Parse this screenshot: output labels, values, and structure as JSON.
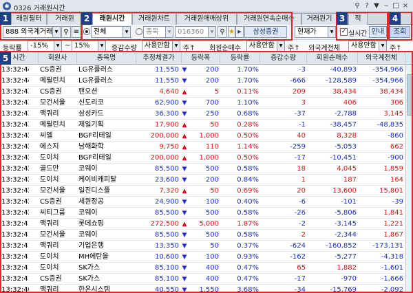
{
  "window": {
    "title": "0326 거래원시간",
    "controls": [
      "⚲",
      "?",
      "▼",
      "‒",
      "□",
      "×"
    ]
  },
  "tabs": [
    {
      "label": "래원필터",
      "active": false
    },
    {
      "label": "거래원",
      "active": false
    },
    {
      "label": "래원시간",
      "active": true
    },
    {
      "label": "거래원차트",
      "active": false
    },
    {
      "label": "거래원매매상위",
      "active": false
    },
    {
      "label": "거래원연속순매수",
      "active": false
    },
    {
      "label": "거래원기",
      "active": false
    },
    {
      "label": "적",
      "active": false
    }
  ],
  "controls": {
    "broker_select": "888 외국계거래원",
    "radio_all": "전체",
    "radio_stock": "종목",
    "stock_code": "016360",
    "stock_name": "삼성증권",
    "price_type": "현재가",
    "realtime_label": "실시간",
    "realtime_checked": true,
    "guide_button": "안내",
    "query_button": "조회"
  },
  "filters": {
    "rate_label": "등락률",
    "rate_from": "-15%",
    "rate_tilde": "~",
    "rate_to": "15%",
    "vol_label": "증감수량",
    "vol_value": "사용안함",
    "vol_unit": "주↑",
    "net_label": "회원순매수",
    "net_value": "사용안함",
    "net_unit": "주↑",
    "for_label": "외국계전체",
    "for_value": "사용안함",
    "for_unit": "주↑"
  },
  "markers": [
    "1",
    "2",
    "3",
    "4",
    "5"
  ],
  "table": {
    "headers": [
      "시간",
      "회원사",
      "종목명",
      "추정체결가",
      "등락폭",
      "등락률",
      "증감수량",
      "회원순매수",
      "외국계전체"
    ],
    "rows": [
      {
        "time": "13:32:44",
        "firm": "CS증권",
        "stock": "LG유플러스",
        "price": "11,550",
        "dir": "down",
        "chg": "200",
        "rate": "1.70%",
        "vol": "-3",
        "net": "-40,893",
        "for": "-354,966"
      },
      {
        "time": "13:32:44",
        "firm": "메릴린치",
        "stock": "LG유플러스",
        "price": "11,550",
        "dir": "down",
        "chg": "200",
        "rate": "1.70%",
        "vol": "-666",
        "net": "-128,589",
        "for": "-354,966"
      },
      {
        "time": "13:32:43",
        "firm": "CS증권",
        "stock": "팬오션",
        "price": "4,640",
        "dir": "up",
        "chg": "5",
        "rate": "0.11%",
        "vol": "209",
        "net": "38,434",
        "for": "38,434"
      },
      {
        "time": "13:32:43",
        "firm": "모건서울",
        "stock": "신도리코",
        "price": "62,900",
        "dir": "down",
        "chg": "700",
        "rate": "1.10%",
        "vol": "3",
        "net": "406",
        "for": "306"
      },
      {
        "time": "13:32:43",
        "firm": "맥쿼리",
        "stock": "삼성카드",
        "price": "36,300",
        "dir": "down",
        "chg": "250",
        "rate": "0.68%",
        "vol": "-37",
        "net": "-2,788",
        "for": "3,145"
      },
      {
        "time": "13:32:43",
        "firm": "메릴린치",
        "stock": "제일기획",
        "price": "17,900",
        "dir": "up",
        "chg": "50",
        "rate": "0.28%",
        "vol": "-1",
        "net": "-38,457",
        "for": "-48,835"
      },
      {
        "time": "13:32:42",
        "firm": "씨엘",
        "stock": "BGF리테일",
        "price": "200,000",
        "dir": "up",
        "chg": "1,000",
        "rate": "0.50%",
        "vol": "40",
        "net": "8,328",
        "for": "-860"
      },
      {
        "time": "13:32:42",
        "firm": "에스지",
        "stock": "남해화학",
        "price": "9,750",
        "dir": "up",
        "chg": "110",
        "rate": "1.14%",
        "vol": "-259",
        "net": "-5,053",
        "for": "662"
      },
      {
        "time": "13:32:42",
        "firm": "도이치",
        "stock": "BGF리테일",
        "price": "200,000",
        "dir": "up",
        "chg": "1,000",
        "rate": "0.50%",
        "vol": "-17",
        "net": "-10,451",
        "for": "-900"
      },
      {
        "time": "13:32:42",
        "firm": "골드만",
        "stock": "코웨이",
        "price": "85,500",
        "dir": "down",
        "chg": "500",
        "rate": "0.58%",
        "vol": "18",
        "net": "4,045",
        "for": "1,859"
      },
      {
        "time": "13:32:42",
        "firm": "도이치",
        "stock": "케이비캐피탈",
        "price": "23,600",
        "dir": "down",
        "chg": "200",
        "rate": "0.84%",
        "vol": "1",
        "net": "187",
        "for": "164"
      },
      {
        "time": "13:32:42",
        "firm": "모건서울",
        "stock": "일진디스플",
        "price": "7,320",
        "dir": "up",
        "chg": "50",
        "rate": "0.69%",
        "vol": "20",
        "net": "13,600",
        "for": "15,801"
      },
      {
        "time": "13:32:42",
        "firm": "CS증권",
        "stock": "세원정공",
        "price": "24,900",
        "dir": "down",
        "chg": "100",
        "rate": "0.40%",
        "vol": "-6",
        "net": "-101",
        "for": "-39"
      },
      {
        "time": "13:32:42",
        "firm": "씨티그룹",
        "stock": "코웨이",
        "price": "85,500",
        "dir": "down",
        "chg": "500",
        "rate": "0.58%",
        "vol": "-26",
        "net": "-5,806",
        "for": "1,841"
      },
      {
        "time": "13:32:41",
        "firm": "맥쿼리",
        "stock": "롯데쇼핑",
        "price": "272,500",
        "dir": "up",
        "chg": "5,000",
        "rate": "1.87%",
        "vol": "-2",
        "net": "-3,145",
        "for": "1,221"
      },
      {
        "time": "13:32:41",
        "firm": "모건서울",
        "stock": "코웨이",
        "price": "85,500",
        "dir": "down",
        "chg": "500",
        "rate": "0.58%",
        "vol": "2",
        "net": "-2,344",
        "for": "1,867"
      },
      {
        "time": "13:32:41",
        "firm": "맥쿼리",
        "stock": "기업은행",
        "price": "13,350",
        "dir": "down",
        "chg": "50",
        "rate": "0.37%",
        "vol": "-624",
        "net": "-160,852",
        "for": "-173,131"
      },
      {
        "time": "13:32:41",
        "firm": "도이치",
        "stock": "MH에탄올",
        "price": "10,600",
        "dir": "down",
        "chg": "100",
        "rate": "0.93%",
        "vol": "-162",
        "net": "-5,277",
        "for": "-4,318"
      },
      {
        "time": "13:32:41",
        "firm": "도이치",
        "stock": "SK가스",
        "price": "85,100",
        "dir": "down",
        "chg": "400",
        "rate": "0.47%",
        "vol": "65",
        "net": "1,882",
        "for": "-1,601"
      },
      {
        "time": "13:32:41",
        "firm": "CS증권",
        "stock": "SK가스",
        "price": "85,100",
        "dir": "down",
        "chg": "400",
        "rate": "0.47%",
        "vol": "-17",
        "net": "-970",
        "for": "-1,666"
      },
      {
        "time": "13:32:40",
        "firm": "맥쿼리",
        "stock": "한온시스템",
        "price": "40,550",
        "dir": "down",
        "chg": "1,550",
        "rate": "3.68%",
        "vol": "-34",
        "net": "-15,769",
        "for": "-2,092"
      }
    ]
  },
  "colors": {
    "up": "#e01414",
    "down": "#1a2fd0",
    "marker": "#1f3f8a",
    "highlight": "#e0262b"
  }
}
